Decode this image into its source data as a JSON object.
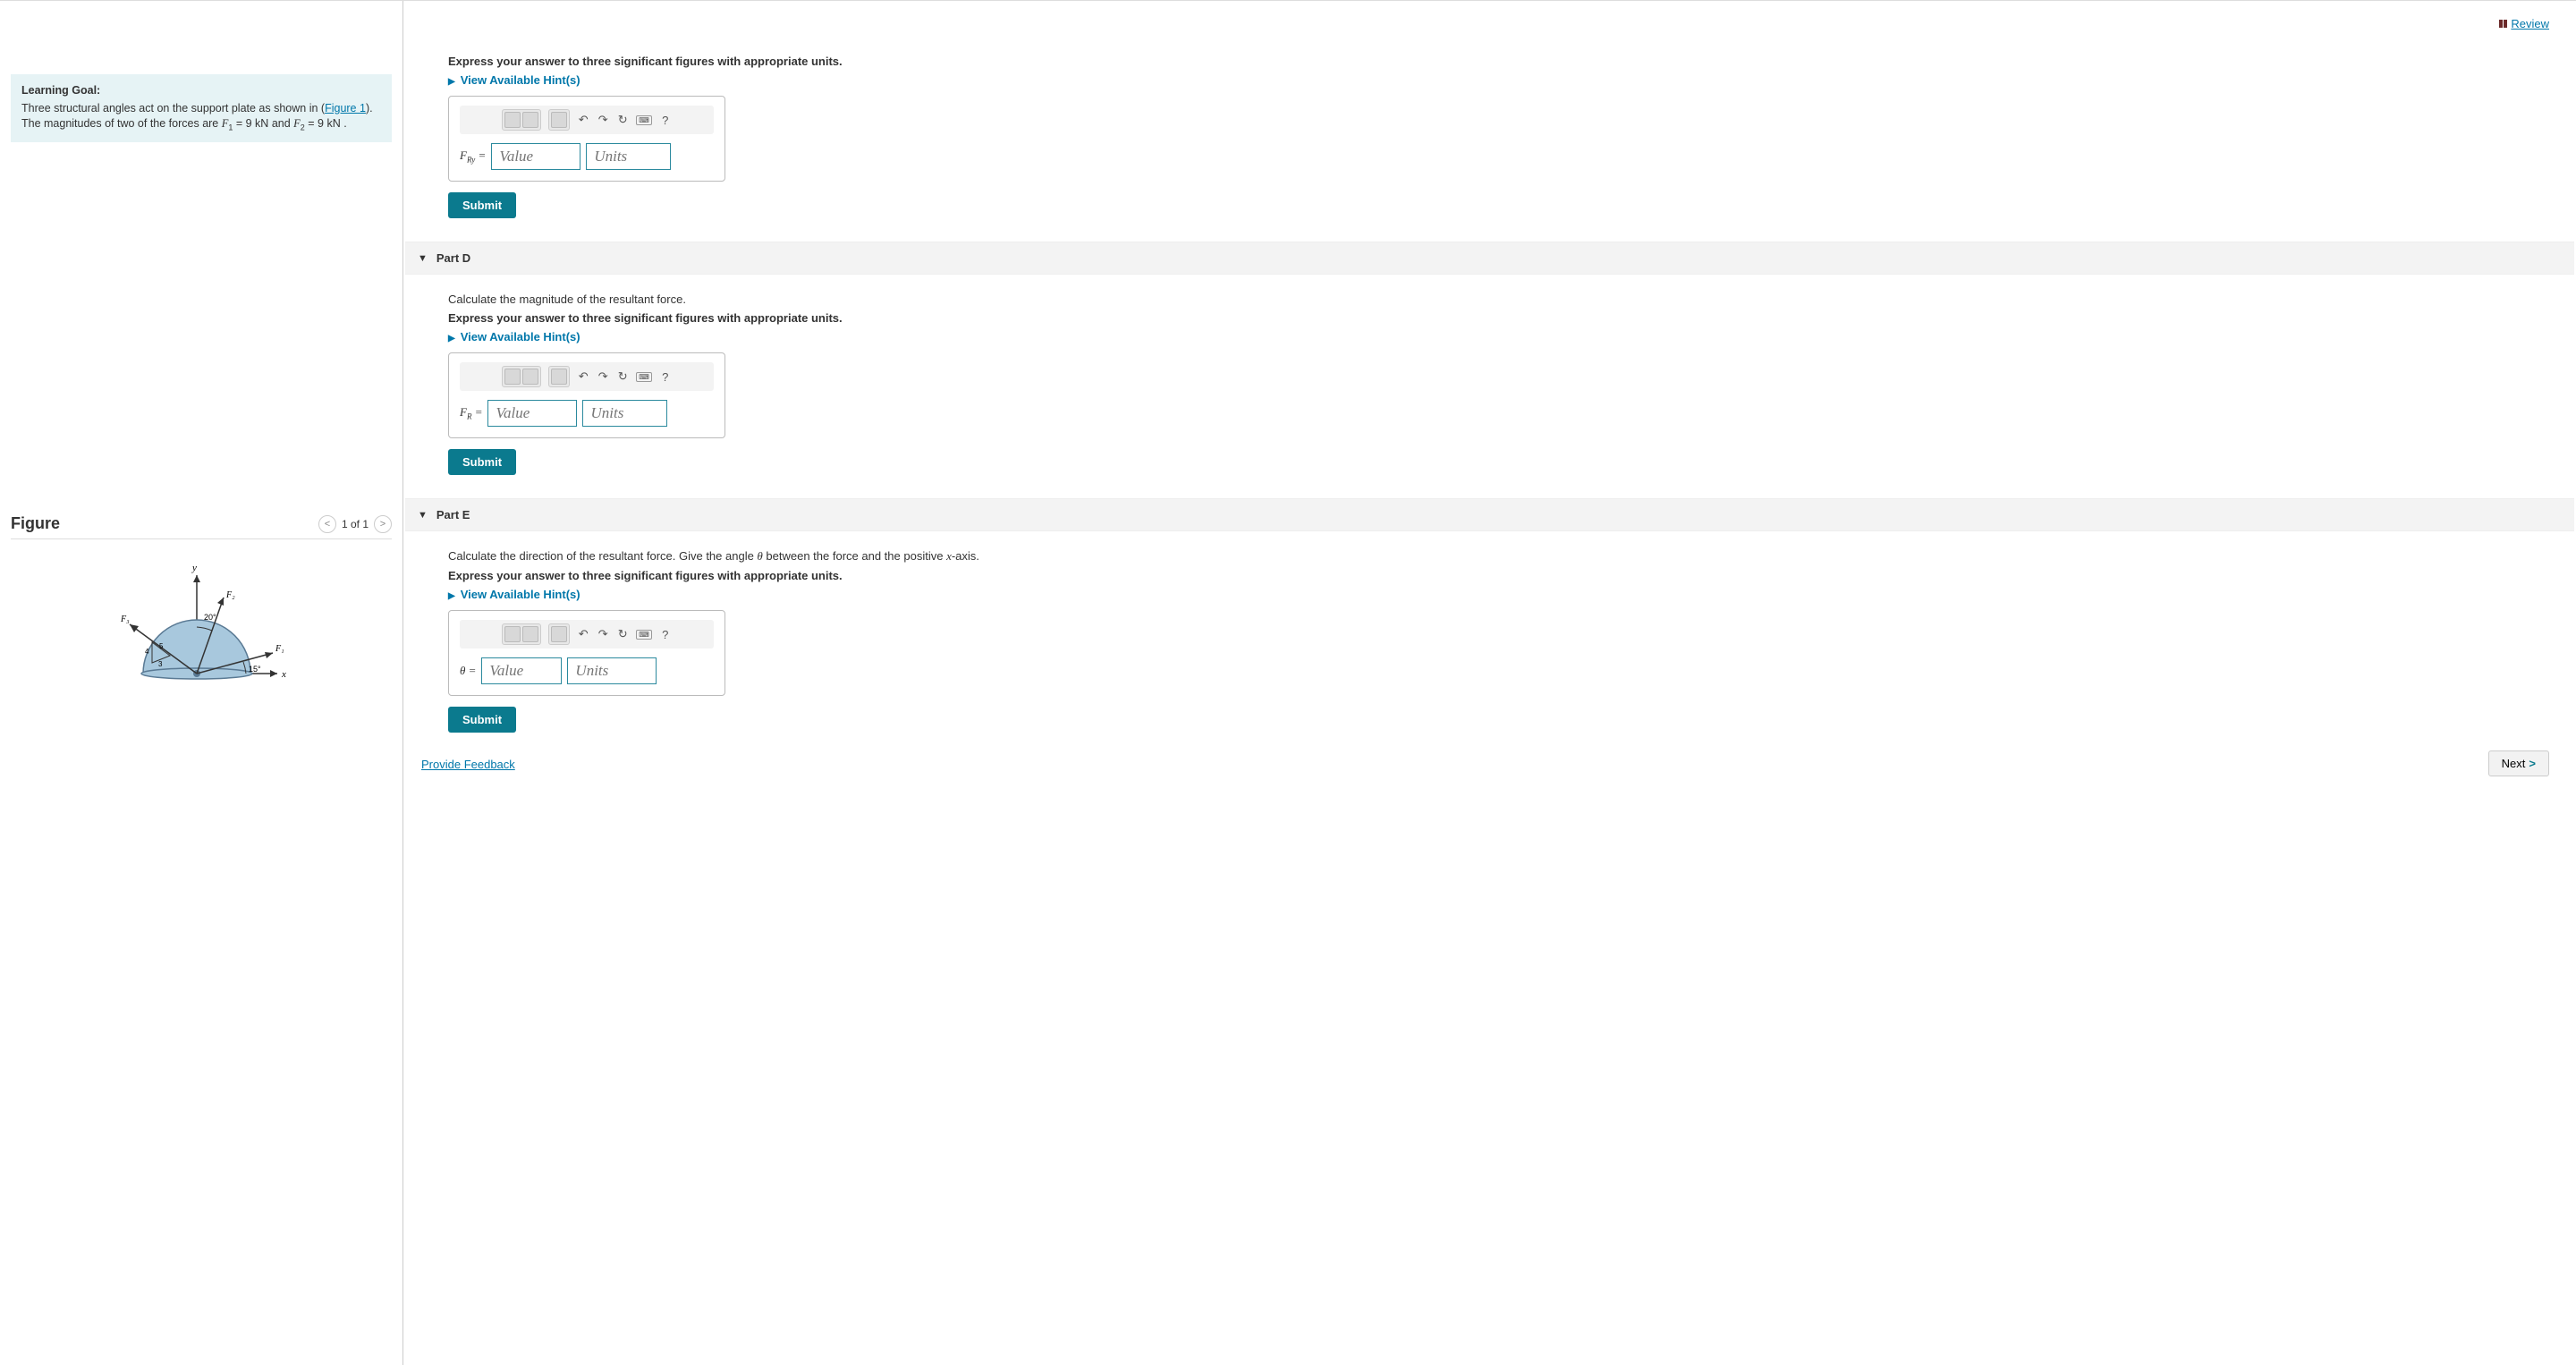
{
  "review_label": "Review",
  "learning_goal": {
    "heading": "Learning Goal:",
    "text_prefix": "Three structural angles act on the support plate as shown in (",
    "figure_link": "Figure 1",
    "text_mid": "). The magnitudes of two of the forces are ",
    "f1_sym": "F",
    "f1_sub": "1",
    "f1_val": " = 9 kN",
    "and": " and ",
    "f2_sym": "F",
    "f2_sub": "2",
    "f2_val": " = 9 kN",
    "period": " ."
  },
  "figure": {
    "title": "Figure",
    "pager": "1 of 1",
    "labels": {
      "y": "y",
      "x": "x",
      "F1": "F₁",
      "F2": "F₂",
      "F3": "F₃",
      "ang20": "20°",
      "ang15": "15°",
      "t3": "3",
      "t4": "4",
      "t5": "5"
    }
  },
  "hints_label": "View Available Hint(s)",
  "value_ph": "Value",
  "units_ph": "Units",
  "submit_label": "Submit",
  "partC": {
    "instr": "Express your answer to three significant figures with appropriate units.",
    "label": "F",
    "label_sub": "Ry",
    "eq": " = "
  },
  "partD": {
    "title": "Part D",
    "prompt": "Calculate the magnitude of the resultant force.",
    "instr": "Express your answer to three significant figures with appropriate units.",
    "label": "F",
    "label_sub": "R",
    "eq": " = "
  },
  "partE": {
    "title": "Part E",
    "prompt_pre": "Calculate the direction of the resultant force. Give the angle ",
    "theta": "θ",
    "prompt_mid": " between the force and the positive ",
    "xvar": "x",
    "prompt_post": "-axis.",
    "instr": "Express your answer to three significant figures with appropriate units.",
    "label": "θ",
    "eq": " = "
  },
  "feedback_label": "Provide Feedback",
  "next_label": "Next"
}
